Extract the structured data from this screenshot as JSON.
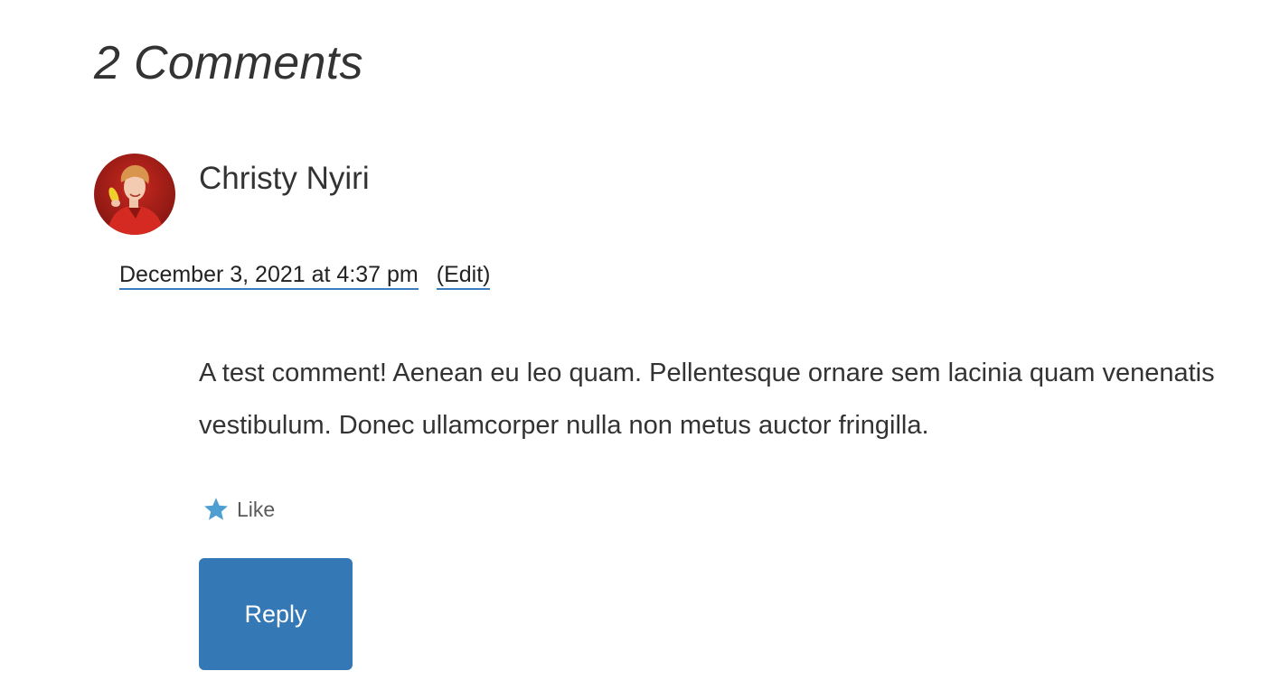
{
  "comments_title": "2 Comments",
  "comment": {
    "author": "Christy Nyiri",
    "avatar_icon": "avatar-photo",
    "date": "December 3, 2021 at 4:37 pm",
    "edit_label": "(Edit)",
    "body": "A test comment! Aenean eu leo quam. Pellentesque ornare sem lacinia quam venenatis vestibulum. Donec ullamcorper nulla non metus auctor fringilla.",
    "like": {
      "icon": "star-icon",
      "label": "Like"
    },
    "reply_label": "Reply"
  },
  "colors": {
    "text": "#333333",
    "link_underline": "#3a7cc0",
    "star": "#4f9ed2",
    "reply_button": "#3478b6",
    "reply_text": "#ffffff"
  }
}
